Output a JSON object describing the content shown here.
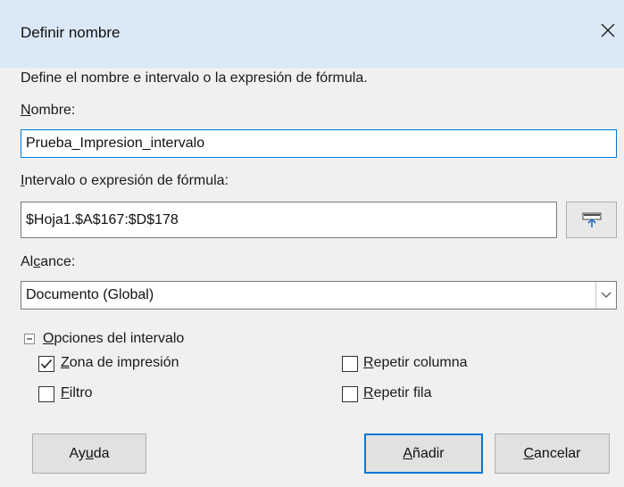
{
  "dialog": {
    "title": "Definir nombre",
    "description": "Define el nombre e intervalo o la expresión de fórmula."
  },
  "name": {
    "label_u": "N",
    "label_rest": "ombre:",
    "value": "Prueba_Impresion_intervalo"
  },
  "range": {
    "label_u": "I",
    "label_rest": "ntervalo o expresión de fórmula:",
    "value": "$Hoja1.$A$167:$D$178"
  },
  "scope": {
    "label_pre": "Al",
    "label_u": "c",
    "label_rest": "ance:",
    "selected": "Documento (Global)"
  },
  "options": {
    "section_label_u": "O",
    "section_label_rest": "pciones del intervalo",
    "print_range": {
      "label_u": "Z",
      "label_rest": "ona de impresión",
      "checked": true
    },
    "filter": {
      "label_u": "F",
      "label_rest": "iltro",
      "checked": false
    },
    "repeat_column": {
      "label_u": "R",
      "label_rest": "epetir columna",
      "checked": false
    },
    "repeat_row": {
      "label_u": "R",
      "label_rest": "epetir fila",
      "checked": false
    }
  },
  "buttons": {
    "help_pre": "Ay",
    "help_u": "u",
    "help_rest": "da",
    "add_u": "A",
    "add_rest": "ñadir",
    "cancel_u": "C",
    "cancel_rest": "ancelar"
  },
  "colors": {
    "titlebar": "#dbe8f6",
    "dialog_bg": "#f0f0f0",
    "focus_accent": "#0078d7"
  }
}
